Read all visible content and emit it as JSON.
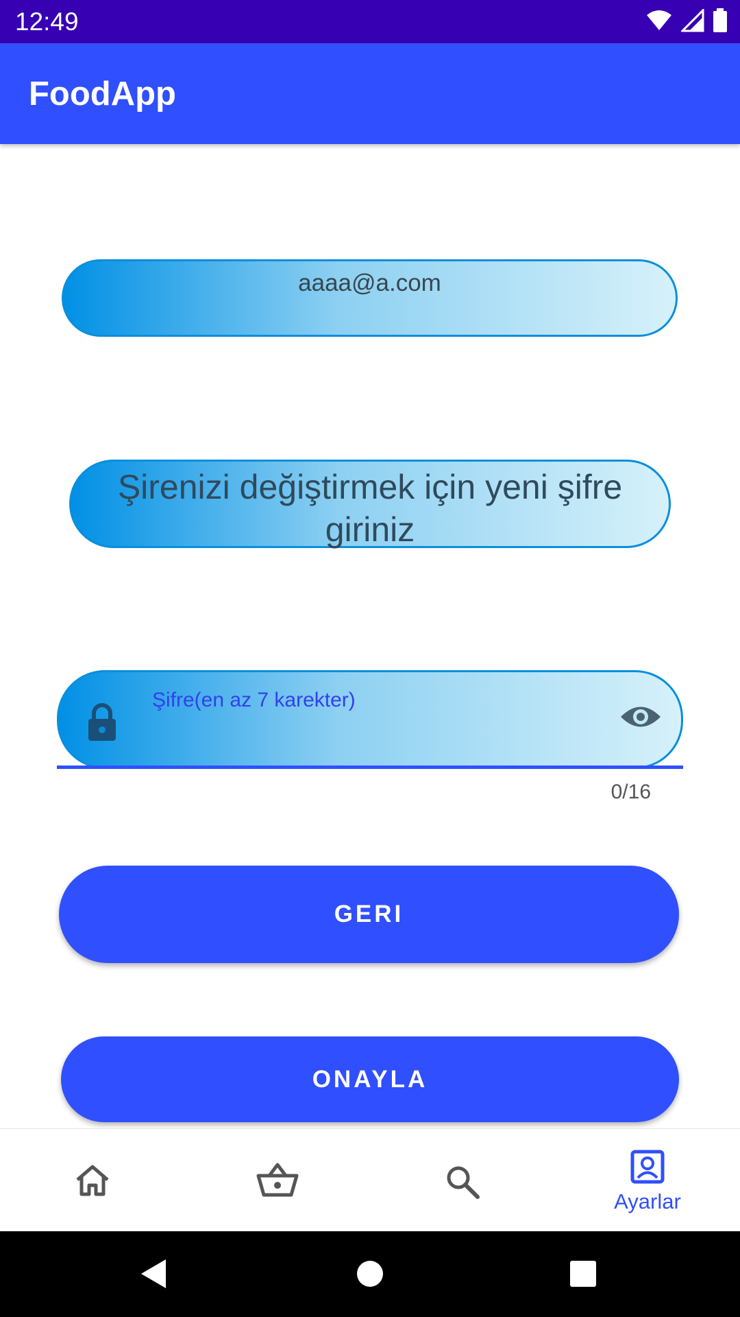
{
  "status_bar": {
    "time": "12:49",
    "icons": [
      "wifi-icon",
      "signal-icon",
      "battery-icon"
    ]
  },
  "app_bar": {
    "title": "FoodApp"
  },
  "email_field": {
    "value": "aaaa@a.com"
  },
  "message": {
    "text": "Şirenizi değiştirmek için yeni şifre giriniz"
  },
  "password_field": {
    "placeholder": "Şifre(en az 7 karekter)",
    "value": "",
    "counter": "0/16",
    "leading_icon": "lock-icon",
    "trailing_icon": "eye-icon"
  },
  "buttons": {
    "back_label": "GERI",
    "confirm_label": "ONAYLA"
  },
  "bottom_nav": {
    "items": [
      {
        "icon": "home-icon",
        "label": ""
      },
      {
        "icon": "basket-icon",
        "label": ""
      },
      {
        "icon": "search-icon",
        "label": ""
      },
      {
        "icon": "account-box-icon",
        "label": "Ayarlar",
        "active": true
      }
    ]
  },
  "colors": {
    "status_bar": "#3700b3",
    "primary": "#304ffe",
    "gradient_start": "#0190e5",
    "gradient_end": "#d6f1fa"
  }
}
